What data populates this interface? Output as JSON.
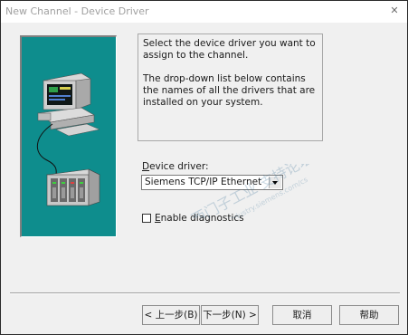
{
  "window": {
    "title": "New Channel - Device Driver",
    "close_label": "✕"
  },
  "description": {
    "paragraph1": "Select the device driver you want to assign to the channel.",
    "paragraph2": "The drop-down list below contains the names of all the drivers that are installed on your system."
  },
  "driver": {
    "label_mnemonic": "D",
    "label_rest": "evice driver:",
    "selected": "Siemens TCP/IP Ethernet"
  },
  "diagnostics": {
    "checked": false,
    "label_mnemonic": "E",
    "label_rest": "nable diagnostics"
  },
  "buttons": {
    "back": "< 上一步(B)",
    "next": "下一步(N) >",
    "cancel": "取消",
    "help": "帮助"
  },
  "colors": {
    "illustration_bg": "#0e8d8d",
    "dialog_bg": "#f0f0f0"
  },
  "watermark": {
    "text": "西门子工业 支持论坛",
    "url": "support.industry.siemens.com/cs"
  }
}
